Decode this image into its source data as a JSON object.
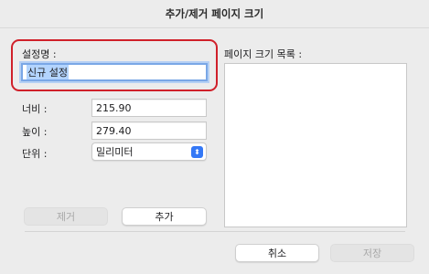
{
  "window": {
    "title": "추가/제거 페이지 크기"
  },
  "form": {
    "name_label": "설정명 :",
    "name_value": "신규 설정",
    "width_label": "너비 :",
    "width_value": "215.90",
    "height_label": "높이 :",
    "height_value": "279.40",
    "unit_label": "단위 :",
    "unit_value": "밀리미터"
  },
  "list": {
    "label": "페이지 크기 목록 :"
  },
  "buttons": {
    "remove": "제거",
    "add": "추가",
    "cancel": "취소",
    "save": "저장"
  },
  "colors": {
    "highlight": "#d0202a",
    "accent": "#3478f6",
    "selection": "#b3d4fe"
  }
}
